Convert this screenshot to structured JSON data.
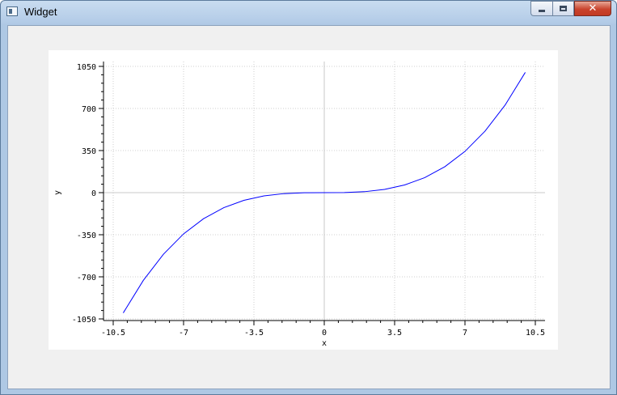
{
  "window": {
    "title": "Widget"
  },
  "title_controls": {
    "minimize_icon": "minimize-icon",
    "maximize_icon": "maximize-icon",
    "close_icon": "close-icon",
    "close_glyph": "✕"
  },
  "chart_data": {
    "type": "line",
    "xlabel": "x",
    "ylabel": "y",
    "xlim": [
      -10.5,
      10.5
    ],
    "ylim": [
      -1050,
      1050
    ],
    "xticks": [
      "-10.5",
      "-7",
      "-3.5",
      "0",
      "3.5",
      "7",
      "10.5"
    ],
    "yticks": [
      "1050",
      "700",
      "350",
      "0",
      "-350",
      "-700",
      "-1050"
    ],
    "grid": true,
    "legend": "none",
    "color": "#0000ff",
    "series": [
      {
        "x": [
          -10,
          -9,
          -8,
          -7,
          -6,
          -5,
          -4,
          -3,
          -2,
          -1,
          0,
          1,
          2,
          3,
          4,
          5,
          6,
          7,
          8,
          9,
          10
        ],
        "y": [
          -1000,
          -729,
          -512,
          -343,
          -216,
          -125,
          -64,
          -27,
          -8,
          -1,
          0,
          1,
          8,
          27,
          64,
          125,
          216,
          343,
          512,
          729,
          1000
        ]
      }
    ]
  }
}
